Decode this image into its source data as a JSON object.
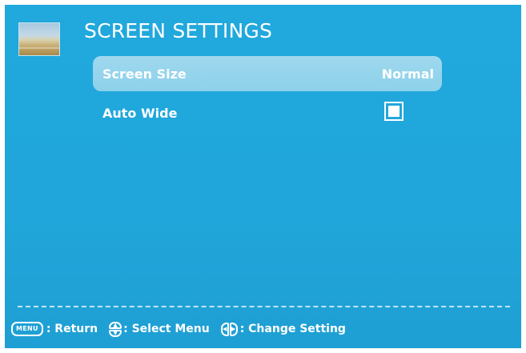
{
  "header": {
    "title": "SCREEN SETTINGS",
    "thumbnail_icon": "landscape-picture-icon"
  },
  "menu": {
    "items": [
      {
        "label": "Screen Size",
        "value": "Normal",
        "selected": true
      },
      {
        "label": "Auto Wide",
        "value_type": "checkbox",
        "checked": true
      }
    ]
  },
  "footer": {
    "menu_key": "MENU",
    "return_label": ": Return",
    "select_label": ": Select Menu",
    "change_label": ": Change Setting",
    "icons": [
      "menu-key-icon",
      "up-down-icon",
      "left-right-icon"
    ]
  },
  "colors": {
    "background": "#20a6da",
    "highlight": "#9fd8ee",
    "text": "#ffffff"
  }
}
